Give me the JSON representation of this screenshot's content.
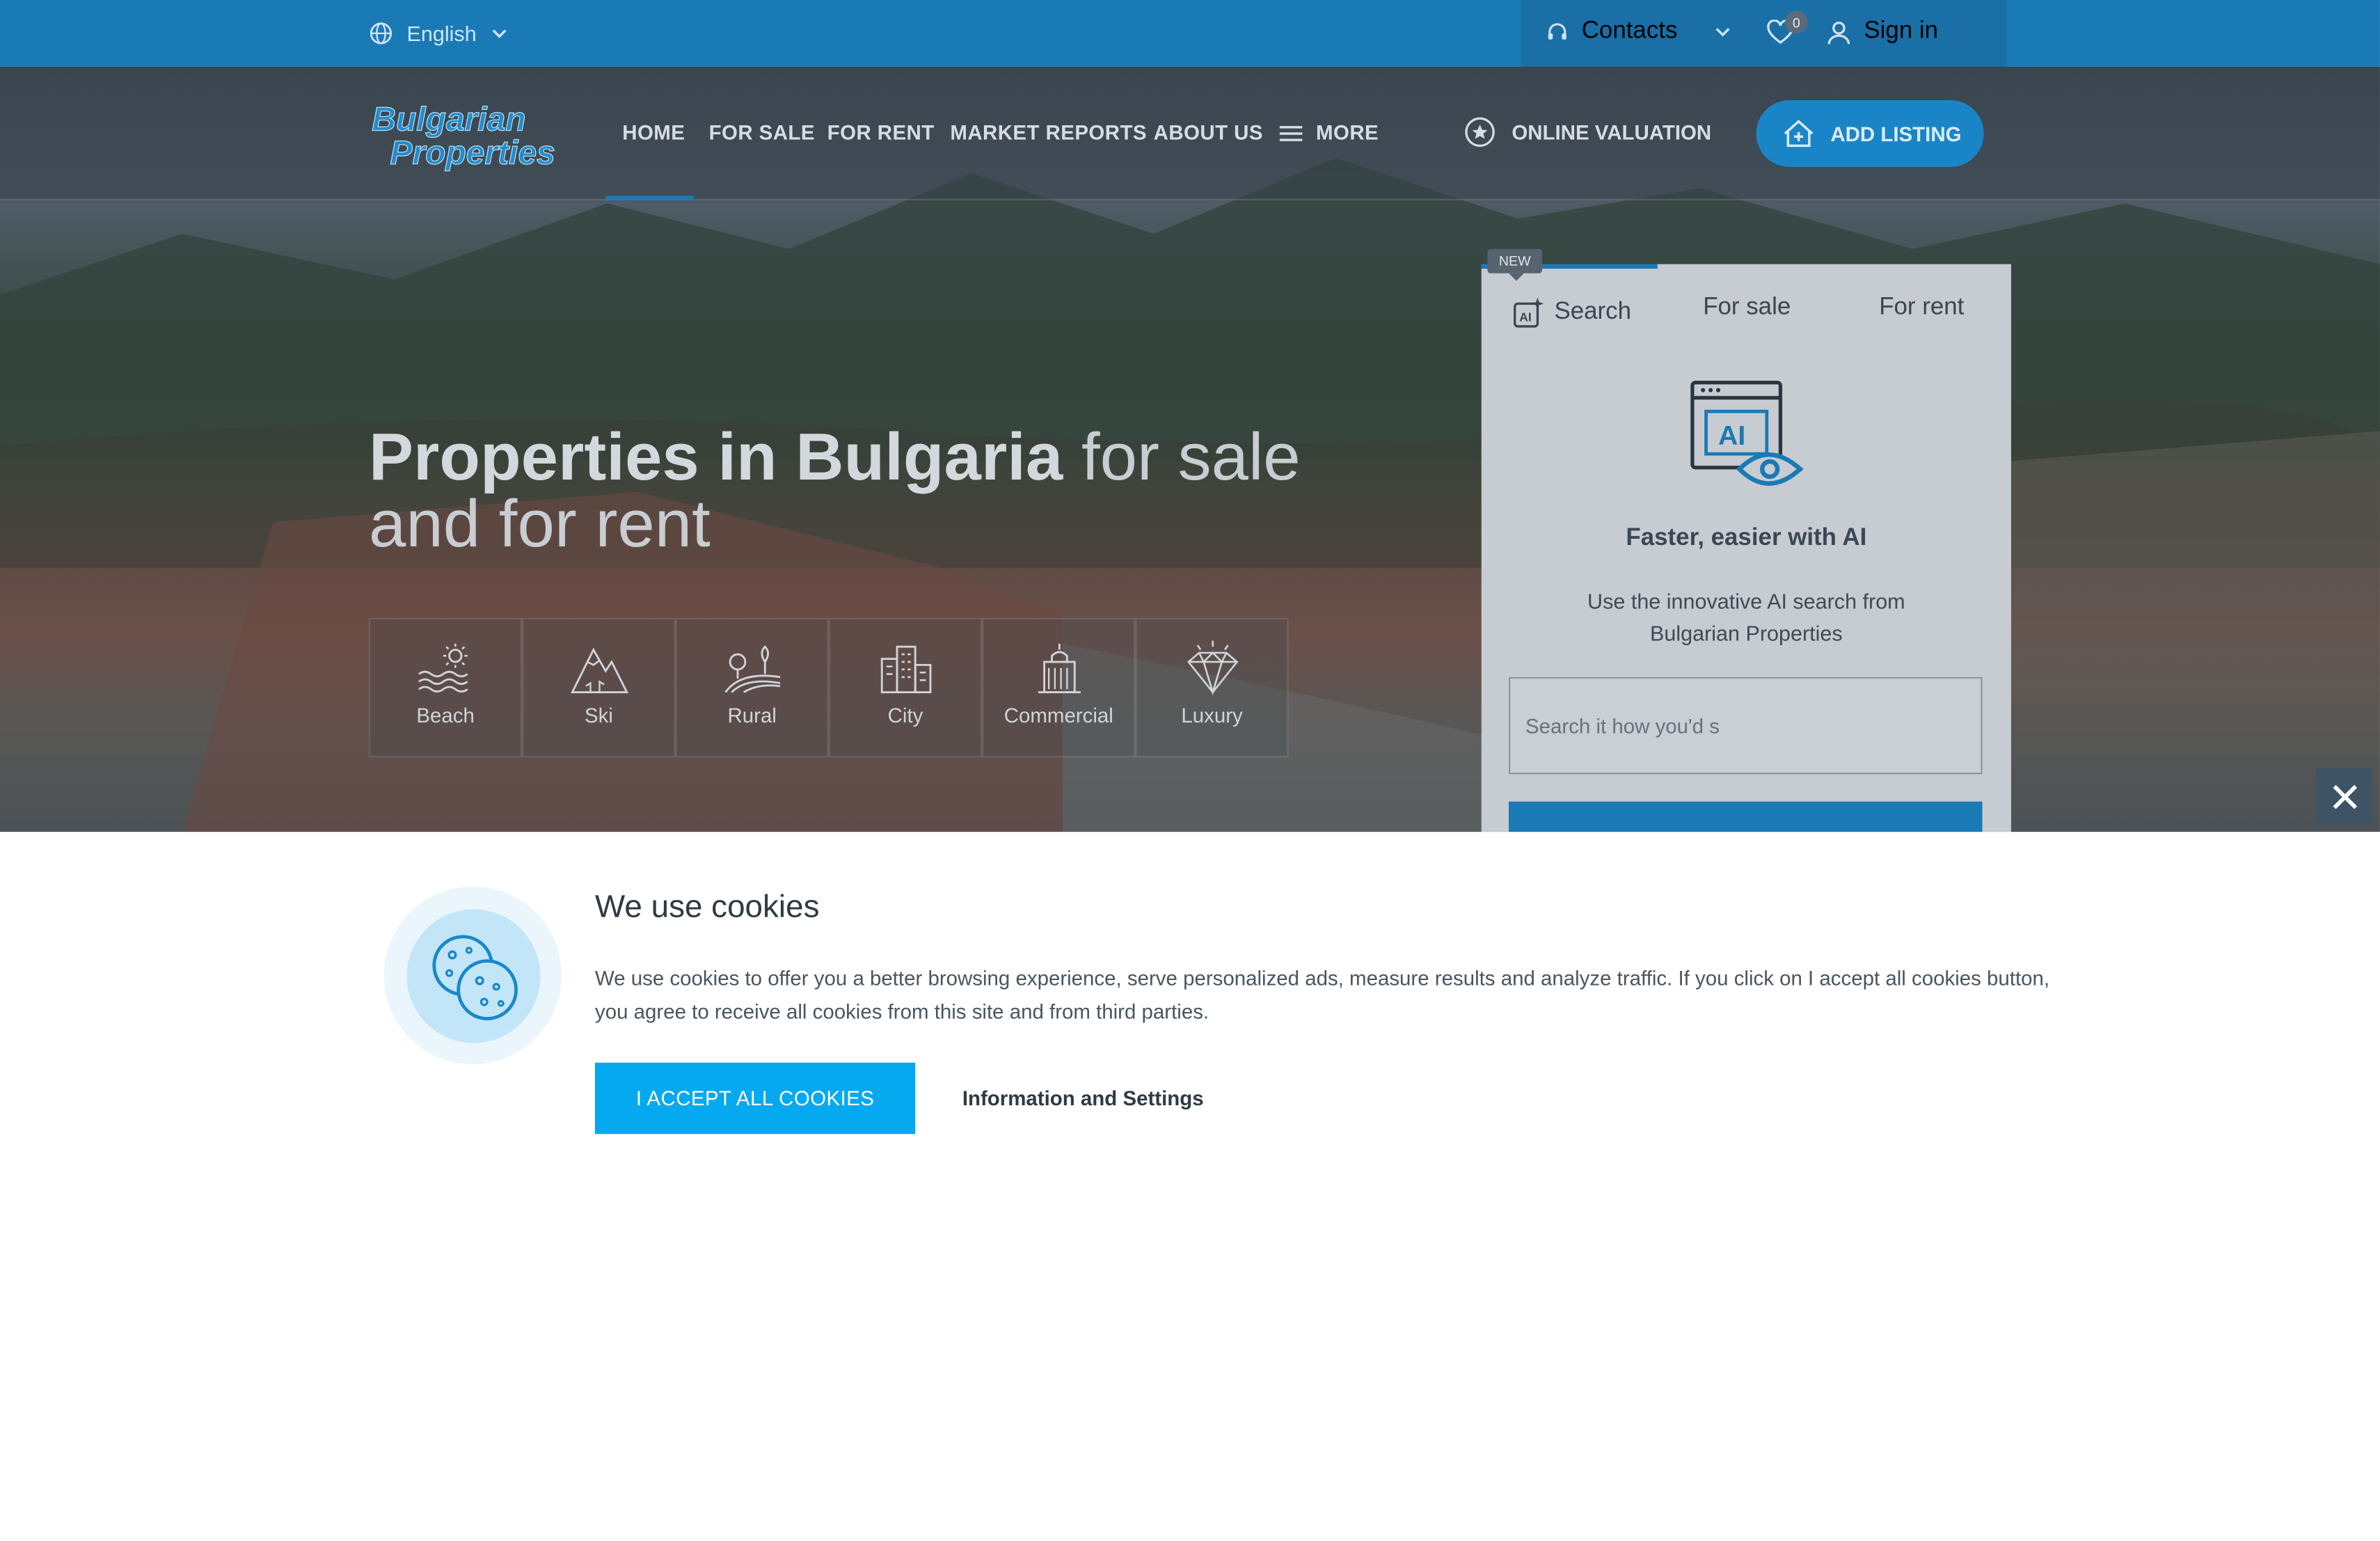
{
  "topbar": {
    "language": "English",
    "contacts": "Contacts",
    "favorites_count": "0",
    "sign_in": "Sign in"
  },
  "nav": {
    "logo_line1": "Bulgarian",
    "logo_line2": "Properties",
    "home": "HOME",
    "for_sale": "FOR SALE",
    "for_rent": "FOR RENT",
    "market_reports": "MARKET REPORTS",
    "about_us": "ABOUT US",
    "more": "MORE",
    "online_valuation": "ONLINE VALUATION",
    "add_listing": "ADD LISTING"
  },
  "hero": {
    "heading_bold": "Properties in Bulgaria",
    "heading_light": " for sale and for rent",
    "categories": [
      {
        "label": "Beach"
      },
      {
        "label": "Ski"
      },
      {
        "label": "Rural"
      },
      {
        "label": "City"
      },
      {
        "label": "Commercial"
      },
      {
        "label": "Luxury"
      }
    ]
  },
  "search_panel": {
    "new_tag": "NEW",
    "tab_search": "Search",
    "tab_for_sale": "For sale",
    "tab_for_rent": "For rent",
    "title": "Faster, easier with AI",
    "subtitle": "Use the innovative AI search from Bulgarian Properties",
    "input_placeholder": "Search it how you'd s"
  },
  "cookies": {
    "title": "We use cookies",
    "text": "We use cookies to offer you a better browsing experience, serve personalized ads, measure results and analyze traffic. If you click on I accept all cookies button, you agree to receive all cookies from this site and from third parties.",
    "accept": "I ACCEPT ALL COOKIES",
    "info": "Information and Settings"
  },
  "colors": {
    "brand_blue": "#1a7ab5",
    "accept_blue": "#05a9ef"
  }
}
